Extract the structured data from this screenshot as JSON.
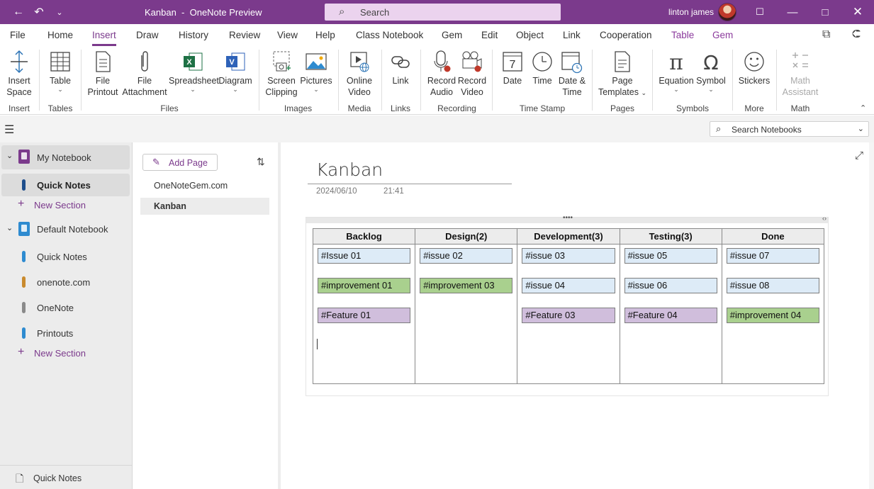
{
  "titlebar": {
    "doc_title": "Kanban  -  OneNote Preview",
    "search_placeholder": "Search",
    "user_name": "linton james"
  },
  "menu": {
    "tabs": [
      "File",
      "Home",
      "Insert",
      "Draw",
      "History",
      "Review",
      "View",
      "Help",
      "Class Notebook",
      "Gem",
      "Edit",
      "Object",
      "Link",
      "Cooperation",
      "Table",
      "Gem"
    ],
    "active": "Insert"
  },
  "ribbon": {
    "buttons": {
      "insert_space": [
        "Insert",
        "Space"
      ],
      "table": [
        "Table"
      ],
      "file_printout": [
        "File",
        "Printout"
      ],
      "file_attachment": [
        "File",
        "Attachment"
      ],
      "spreadsheet": [
        "Spreadsheet"
      ],
      "diagram": [
        "Diagram"
      ],
      "screen_clipping": [
        "Screen",
        "Clipping"
      ],
      "pictures": [
        "Pictures"
      ],
      "online_video": [
        "Online",
        "Video"
      ],
      "link": [
        "Link"
      ],
      "record_audio": [
        "Record",
        "Audio"
      ],
      "record_video": [
        "Record",
        "Video"
      ],
      "date": [
        "Date"
      ],
      "time": [
        "Time"
      ],
      "date_time": [
        "Date &",
        "Time"
      ],
      "page_templates": [
        "Page",
        "Templates"
      ],
      "equation": [
        "Equation"
      ],
      "symbol": [
        "Symbol"
      ],
      "stickers": [
        "Stickers"
      ],
      "math_assistant": [
        "Math",
        "Assistant"
      ]
    },
    "groups": {
      "insert": "Insert",
      "tables": "Tables",
      "files": "Files",
      "images": "Images",
      "media": "Media",
      "links": "Links",
      "recording": "Recording",
      "time_stamp": "Time Stamp",
      "pages": "Pages",
      "symbols": "Symbols",
      "more": "More",
      "math": "Math"
    },
    "date_icon_number": "7"
  },
  "search_notebooks": {
    "placeholder": "Search Notebooks"
  },
  "sidebar": {
    "my_notebook": "My Notebook",
    "my_quick_notes": "Quick Notes",
    "new_section_1": "New Section",
    "default_notebook": "Default Notebook",
    "sections": [
      "Quick Notes",
      "onenote.com",
      "OneNote",
      "Printouts"
    ],
    "new_section_2": "New Section",
    "bottom_quick_notes": "Quick Notes",
    "colors": {
      "my_notebook": "#7B3A8C",
      "default_notebook": "#2E8BD0",
      "quick_notes_tab": "#1E4E8C",
      "section_tabs": [
        "#2E8BD0",
        "#C98A2E",
        "#8A8A8A",
        "#2E8BD0"
      ]
    }
  },
  "pagelist": {
    "add_page": "Add Page",
    "pages": [
      "OneNoteGem.com",
      "Kanban"
    ],
    "selected": "Kanban"
  },
  "page": {
    "title": "Kanban",
    "date": "2024/06/10",
    "time": "21:41"
  },
  "kanban": {
    "columns": [
      "Backlog",
      "Design(2)",
      "Development(3)",
      "Testing(3)",
      "Done"
    ],
    "cards": [
      [
        {
          "text": "#Issue 01",
          "kind": "issue"
        },
        {
          "text": "#improvement 01",
          "kind": "improve"
        },
        {
          "text": "#Feature 01",
          "kind": "feature"
        }
      ],
      [
        {
          "text": "#issue 02",
          "kind": "issue"
        },
        {
          "text": "#improvement 03",
          "kind": "improve"
        }
      ],
      [
        {
          "text": "#issue 03",
          "kind": "issue"
        },
        {
          "text": "#issue 04",
          "kind": "issue"
        },
        {
          "text": "#Feature 03",
          "kind": "feature"
        }
      ],
      [
        {
          "text": "#issue 05",
          "kind": "issue"
        },
        {
          "text": "#issue 06",
          "kind": "issue"
        },
        {
          "text": "#Feature 04",
          "kind": "feature"
        }
      ],
      [
        {
          "text": "#issue 07",
          "kind": "issue"
        },
        {
          "text": "#issue 08",
          "kind": "issue"
        },
        {
          "text": "#improvement 04",
          "kind": "improve"
        }
      ]
    ],
    "colors": {
      "issue": "#DDEBF7",
      "improve": "#A9D08E",
      "feature": "#D0BEDC"
    }
  },
  "theme": {
    "accent": "#7B3A8C"
  }
}
